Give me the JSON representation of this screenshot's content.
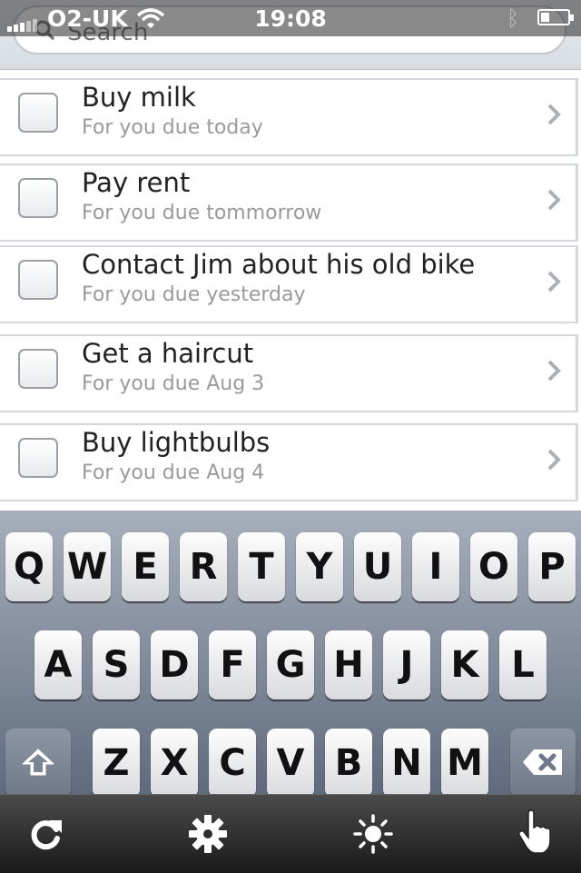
{
  "status_bar": {
    "carrier": "O2-UK",
    "time": "19:08"
  },
  "search": {
    "placeholder": "Search"
  },
  "tasks": [
    {
      "title": "Buy milk",
      "subtitle": "For you due today",
      "checked": false
    },
    {
      "title": "Pay rent",
      "subtitle": "For you due tommorrow",
      "checked": false
    },
    {
      "title": "Contact Jim about his old bike",
      "subtitle": "For you due yesterday",
      "checked": false
    },
    {
      "title": "Get a haircut",
      "subtitle": "For you due Aug 3",
      "checked": false
    },
    {
      "title": "Buy lightbulbs",
      "subtitle": "For you due Aug 4",
      "checked": false
    }
  ],
  "keyboard": {
    "row1": [
      "Q",
      "W",
      "E",
      "R",
      "T",
      "Y",
      "U",
      "I",
      "O",
      "P"
    ],
    "row2": [
      "A",
      "S",
      "D",
      "F",
      "G",
      "H",
      "J",
      "K",
      "L"
    ],
    "row3": [
      "Z",
      "X",
      "C",
      "V",
      "B",
      "N",
      "M"
    ]
  },
  "toolbar": {
    "items": [
      {
        "icon": "refresh-icon"
      },
      {
        "icon": "gear-icon"
      },
      {
        "icon": "brightness-icon"
      },
      {
        "icon": "hand-pointer-icon"
      }
    ]
  }
}
